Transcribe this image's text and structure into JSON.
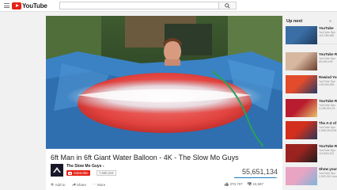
{
  "masthead": {
    "logo_text": "YouTube",
    "search_placeholder": ""
  },
  "video": {
    "title": "6ft Man in 6ft Giant Water Balloon - 4K - The Slow Mo Guys",
    "channel": "The Slow Mo Guys",
    "subscribe_label": "Subscribe",
    "subscriber_count": "7,930,224",
    "view_count": "55,651,134",
    "like_count": "370,707",
    "dislike_count": "10,587",
    "like_ratio": 0.97
  },
  "actions": {
    "add_label": "Add to",
    "share_label": "Share",
    "more_label": "More"
  },
  "sidebar": {
    "header": "Up next",
    "autoplay_label": "A",
    "items": [
      {
        "title": "YouTube",
        "channel": "YouTube Spo",
        "views": "116,785,486",
        "duration": "",
        "colors": [
          "#3a6ea5",
          "#1f3c5e"
        ]
      },
      {
        "title": "YouTube R",
        "channel": "YouTube Spo",
        "views": "65,460,494",
        "duration": "",
        "colors": [
          "#d7b7a0",
          "#6a3c2a"
        ]
      },
      {
        "title": "Rewind You",
        "channel": "YouTube Spo",
        "views": "128,060,826",
        "duration": "",
        "colors": [
          "#e24b2b",
          "#263a66"
        ]
      },
      {
        "title": "YouTube R",
        "channel": "YouTube Spo",
        "views": "3,438,331,03",
        "duration": "",
        "colors": [
          "#b91c2f",
          "#e7c36a"
        ]
      },
      {
        "title": "The A-Z of",
        "channel": "YouTube Spo",
        "views": "2,068,349,026",
        "duration": "",
        "colors": [
          "#d22f1c",
          "#2b3658"
        ]
      },
      {
        "title": "YouTube R",
        "channel": "YouTube Spo",
        "views": "115,563,023",
        "duration": "",
        "colors": [
          "#9a2320",
          "#1d1d1d"
        ]
      },
      {
        "title": "Show your p",
        "channel": "YouTube Spo",
        "views": "2,090,391 views",
        "duration": "",
        "colors": [
          "#e9a4c4",
          "#7fb4d8"
        ]
      }
    ]
  }
}
